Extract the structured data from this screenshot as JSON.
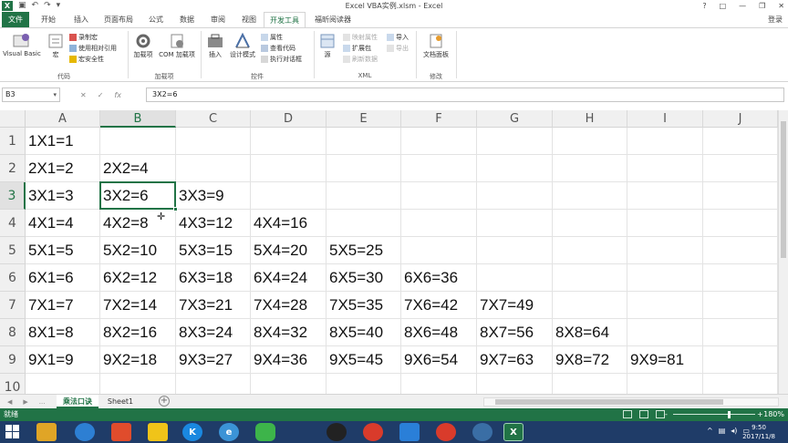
{
  "window": {
    "title": "Excel VBA实例.xlsm - Excel",
    "controls": [
      "?",
      "□",
      "—",
      "❐",
      "✕"
    ],
    "qat": [
      "↶",
      "↷",
      "▾"
    ]
  },
  "tabs": [
    {
      "label": "文件"
    },
    {
      "label": "开始"
    },
    {
      "label": "插入"
    },
    {
      "label": "页面布局"
    },
    {
      "label": "公式"
    },
    {
      "label": "数据"
    },
    {
      "label": "审阅"
    },
    {
      "label": "视图"
    },
    {
      "label": "开发工具"
    },
    {
      "label": "福昕阅读器"
    }
  ],
  "user": "登录",
  "ribbon": {
    "code": {
      "visual_basic": "Visual Basic",
      "macros": "宏",
      "record_macro": "录制宏",
      "relative_ref": "使用相对引用",
      "macro_security": "宏安全性",
      "group": "代码"
    },
    "addins": {
      "addins": "加载项",
      "com": "COM 加载项",
      "group": "加载项"
    },
    "controls": {
      "insert": "插入",
      "design_mode": "设计模式",
      "properties": "属性",
      "view_code": "查看代码",
      "run_dialog": "执行对话框",
      "group": "控件"
    },
    "xml": {
      "source": "源",
      "map_props": "映射属性",
      "expansion": "扩展包",
      "refresh": "刷新数据",
      "import": "导入",
      "export": "导出",
      "group": "XML"
    },
    "modify": {
      "doc_panel": "文档面板",
      "group": "修改"
    }
  },
  "formula_bar": {
    "name_box": "B3",
    "formula": "3X2=6",
    "icons": [
      "✕",
      "✓",
      "fx"
    ]
  },
  "sheet": {
    "columns": [
      "A",
      "B",
      "C",
      "D",
      "E",
      "F",
      "G",
      "H",
      "I",
      "J"
    ],
    "rows": [
      "1",
      "2",
      "3",
      "4",
      "5",
      "6",
      "7",
      "8",
      "9",
      "10"
    ],
    "selected_column": "B",
    "selected_row": "3",
    "cells": [
      [
        "1X1=1"
      ],
      [
        "2X1=2",
        "2X2=4"
      ],
      [
        "3X1=3",
        "3X2=6",
        "3X3=9"
      ],
      [
        "4X1=4",
        "4X2=8",
        "4X3=12",
        "4X4=16"
      ],
      [
        "5X1=5",
        "5X2=10",
        "5X3=15",
        "5X4=20",
        "5X5=25"
      ],
      [
        "6X1=6",
        "6X2=12",
        "6X3=18",
        "6X4=24",
        "6X5=30",
        "6X6=36"
      ],
      [
        "7X1=7",
        "7X2=14",
        "7X3=21",
        "7X4=28",
        "7X5=35",
        "7X6=42",
        "7X7=49"
      ],
      [
        "8X1=8",
        "8X2=16",
        "8X3=24",
        "8X4=32",
        "8X5=40",
        "8X6=48",
        "8X7=56",
        "8X8=64"
      ],
      [
        "9X1=9",
        "9X2=18",
        "9X3=27",
        "9X4=36",
        "9X5=45",
        "9X6=54",
        "9X7=63",
        "9X8=72",
        "9X9=81"
      ]
    ]
  },
  "sheet_tabs": [
    {
      "label": "乘法口诀",
      "active": true
    },
    {
      "label": "Sheet1",
      "active": false
    }
  ],
  "sheet_nav": [
    "◀",
    "▶",
    "..."
  ],
  "status": {
    "ready": "就绪",
    "zoom_minus": "-",
    "zoom_plus": "+",
    "zoom": "180%"
  },
  "taskbar": {
    "time": "9:50",
    "date": "2017/11/8",
    "icons": [
      "file-explorer-icon",
      "media-player-icon",
      "app-icon",
      "kugou-icon",
      "edge-icon",
      "wechat-icon",
      "qq-icon",
      "chrome-icon",
      "feishu-icon",
      "chrome-icon",
      "app-icon",
      "excel-icon"
    ]
  },
  "colors": {
    "excel_green": "#217346",
    "taskbar": "#1f3c68"
  }
}
